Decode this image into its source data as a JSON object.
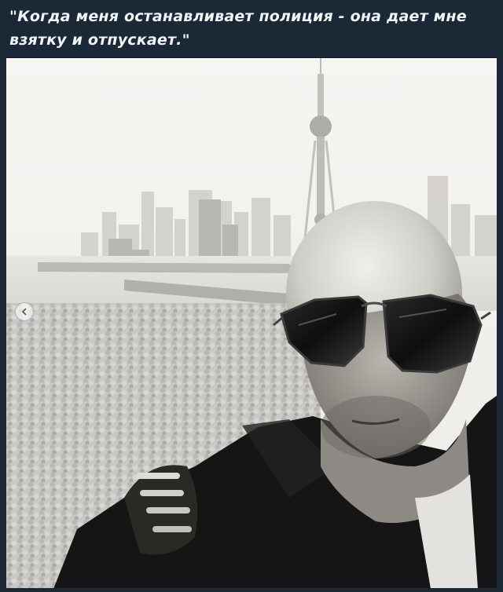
{
  "post": {
    "caption": "\"Когда меня останавливает полиция - она дает мне взятку и отпускает.\""
  },
  "photo": {
    "style": "black-and-white selfie",
    "subject": "man in aviator sunglasses and dark jacket",
    "background": "city skyline with TV tower over river and trees"
  },
  "controls": {
    "carousel_prev_icon": "chevron-left-icon"
  },
  "colors": {
    "page_background": "#1b2836",
    "caption_text": "#f2f5f8",
    "photo_sky": "#f4f3f0"
  }
}
